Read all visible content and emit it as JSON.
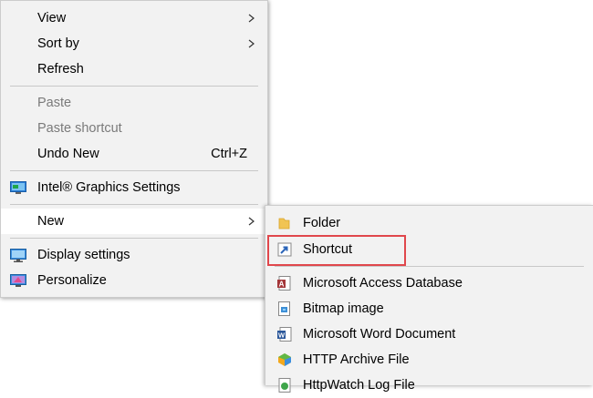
{
  "main_menu": {
    "items": [
      {
        "label": "View",
        "has_submenu": true,
        "icon": ""
      },
      {
        "label": "Sort by",
        "has_submenu": true,
        "icon": ""
      },
      {
        "label": "Refresh",
        "has_submenu": false,
        "icon": ""
      },
      {
        "label": "Paste",
        "disabled": true,
        "icon": ""
      },
      {
        "label": "Paste shortcut",
        "disabled": true,
        "icon": ""
      },
      {
        "label": "Undo New",
        "shortcut": "Ctrl+Z",
        "icon": ""
      },
      {
        "label": "Intel® Graphics Settings",
        "icon": "intel-graphics-icon"
      },
      {
        "label": "New",
        "has_submenu": true,
        "active": true,
        "icon": ""
      },
      {
        "label": "Display settings",
        "icon": "display-settings-icon"
      },
      {
        "label": "Personalize",
        "icon": "personalize-icon"
      }
    ]
  },
  "new_submenu": {
    "items": [
      {
        "label": "Folder",
        "icon": "folder-icon"
      },
      {
        "label": "Shortcut",
        "icon": "shortcut-icon",
        "highlighted": true
      },
      {
        "label": "Microsoft Access Database",
        "icon": "access-icon"
      },
      {
        "label": "Bitmap image",
        "icon": "bitmap-icon"
      },
      {
        "label": "Microsoft Word Document",
        "icon": "word-icon"
      },
      {
        "label": "HTTP Archive File",
        "icon": "http-archive-icon"
      },
      {
        "label": "HttpWatch Log File",
        "icon": "httpwatch-log-icon"
      }
    ]
  },
  "colors": {
    "menu_bg": "#f2f2f2",
    "hover_bg": "#ffffff",
    "disabled_text": "#7a7a7a",
    "highlight_border": "#e0474c"
  }
}
